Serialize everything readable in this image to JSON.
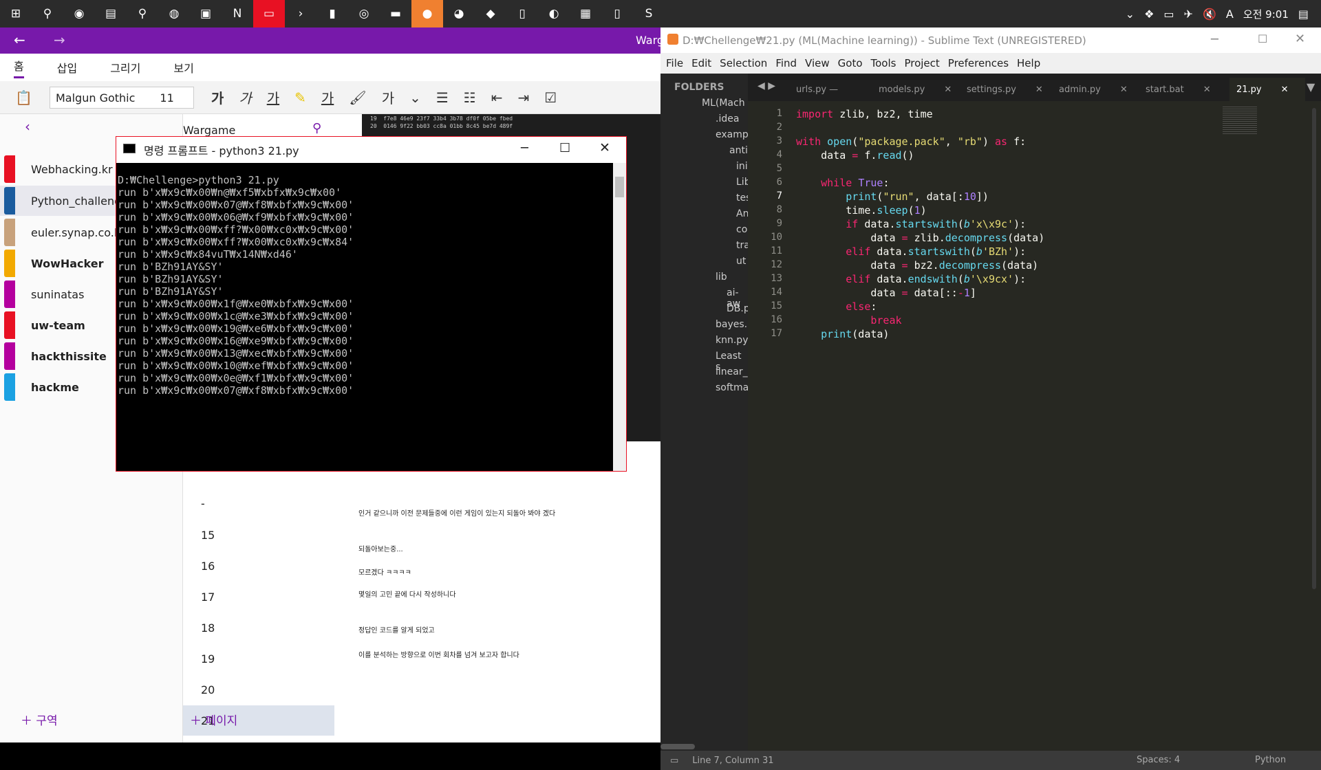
{
  "taskbar": {
    "clock": "오전 9:01",
    "ime": "A"
  },
  "onenote": {
    "title": "Warg",
    "tabs": [
      "홈",
      "삽입",
      "그리기",
      "보기"
    ],
    "font_name": "Malgun Gothic",
    "font_size": "11",
    "section_header": "Wargame",
    "sections": [
      {
        "label": "Webhacking.kr",
        "color": "#e81123",
        "bold": false
      },
      {
        "label": "Python_challenge",
        "color": "#1b5c9e",
        "bold": false
      },
      {
        "label": "euler.synap.co.kr",
        "color": "#c8a27c",
        "bold": false
      },
      {
        "label": "WowHacker",
        "color": "#f2a900",
        "bold": true
      },
      {
        "label": "suninatas",
        "color": "#b4009e",
        "bold": false
      },
      {
        "label": "uw-team",
        "color": "#e81123",
        "bold": true
      },
      {
        "label": "hackthissite",
        "color": "#b4009e",
        "bold": true
      },
      {
        "label": "hackme",
        "color": "#1ba1e2",
        "bold": true
      }
    ],
    "pages": [
      "-",
      "15",
      "16",
      "17",
      "18",
      "19",
      "20",
      "21"
    ],
    "add_section": "구역",
    "add_page": "페이지",
    "note_lines": [
      "인거 같으니까 이전 문제들중에 이런 게임이 있는지 되돌아 봐야 겠다",
      "되돌아보는중...",
      "모르겠다 ㅋㅋㅋㅋ",
      "몇일의 고민 끝에 다시 작성하니다",
      "정답인 코드를 알게 되었고",
      "이를 분석하는 방향으로 이번 회차를 넘겨 보고자 합니다"
    ],
    "hex_lines": [
      "19  f7e8 46e9 23f7 33b4 3b78 df0f 05be fbed",
      "20  0146 9f22 bb03 cc8a 01bb 8c45 be7d 489f"
    ]
  },
  "cmd": {
    "title": "명령 프롬프트 - python3  21.py",
    "lines": [
      "D:₩Chellenge>python3 21.py",
      "run b'x₩x9c₩x00₩n@₩xf5₩xbfx₩x9c₩x00'",
      "run b'x₩x9c₩x00₩x07@₩xf8₩xbfx₩x9c₩x00'",
      "run b'x₩x9c₩x00₩x06@₩xf9₩xbfx₩x9c₩x00'",
      "run b'x₩x9c₩x00₩xff?₩x00₩xc0x₩x9c₩x00'",
      "run b'x₩x9c₩x00₩xff?₩x00₩xc0x₩x9c₩x84'",
      "run b'x₩x9c₩x84vuT₩x14N₩xd46'",
      "run b'BZh91AY&SY'",
      "run b'BZh91AY&SY'",
      "run b'BZh91AY&SY'",
      "run b'x₩x9c₩x00₩x1f@₩xe0₩xbfx₩x9c₩x00'",
      "run b'x₩x9c₩x00₩x1c@₩xe3₩xbfx₩x9c₩x00'",
      "run b'x₩x9c₩x00₩x19@₩xe6₩xbfx₩x9c₩x00'",
      "run b'x₩x9c₩x00₩x16@₩xe9₩xbfx₩x9c₩x00'",
      "run b'x₩x9c₩x00₩x13@₩xec₩xbfx₩x9c₩x00'",
      "run b'x₩x9c₩x00₩x10@₩xef₩xbfx₩x9c₩x00'",
      "run b'x₩x9c₩x00₩x0e@₩xf1₩xbfx₩x9c₩x00'",
      "run b'x₩x9c₩x00₩x07@₩xf8₩xbfx₩x9c₩x00'"
    ]
  },
  "sublime": {
    "title": "D:₩Chellenge₩21.py (ML(Machine learning)) - Sublime Text (UNREGISTERED)",
    "menu": [
      "File",
      "Edit",
      "Selection",
      "Find",
      "View",
      "Goto",
      "Tools",
      "Project",
      "Preferences",
      "Help"
    ],
    "folders_label": "FOLDERS",
    "tree": [
      "ML(Mach",
      ".idea",
      "exampl",
      "anti-",
      "ini",
      "Lib",
      "tes",
      "An",
      "co",
      "tra",
      "ut",
      "lib",
      "ai-aw",
      "DB.p",
      "bayes.p",
      "knn.py",
      "Least s",
      "linear_",
      "softma"
    ],
    "tabs": [
      "urls.py —",
      "models.py",
      "settings.py",
      "admin.py",
      "start.bat",
      "21.py"
    ],
    "status_left": "Line 7, Column 31",
    "status_spaces": "Spaces: 4",
    "status_lang": "Python"
  }
}
